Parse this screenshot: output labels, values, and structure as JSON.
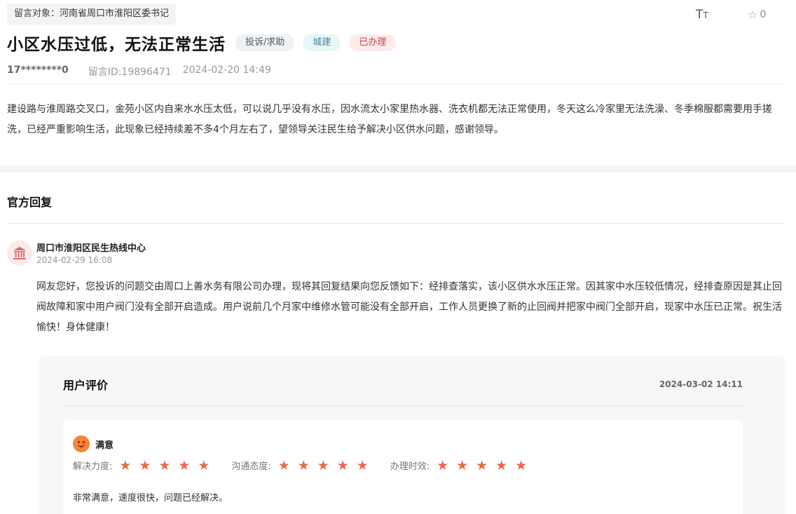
{
  "header": {
    "target_label": "留言对象：",
    "target_value": "河南省周口市淮阳区委书记",
    "font_toggle_big": "T",
    "font_toggle_small": "T",
    "favorite_count": "0"
  },
  "message": {
    "title": "小区水压过低，无法正常生活",
    "tags": [
      "投诉/求助",
      "城建",
      "已办理"
    ],
    "phone": "17********0",
    "message_id": "留言ID:19896471",
    "datetime": "2024-02-20 14:49",
    "content": "建设路与淮周路交叉口，金苑小区内自来水水压太低，可以说几乎没有水压，因水流太小家里热水器、洗衣机都无法正常使用，冬天这么冷家里无法洗澡、冬季棉服都需要用手搓洗，已经严重影响生活，此现象已经持续差不多4个月左右了，望领导关注民生给予解决小区供水问题，感谢领导。"
  },
  "reply": {
    "section_title": "官方回复",
    "org_name": "周口市淮阳区民生热线中心",
    "time": "2024-02-29 16:08",
    "content": "网友您好，您投诉的问题交由周口上善水务有限公司办理，现将其回复结果向您反馈如下：经排查落实，该小区供水水压正常。因其家中水压较低情况，经排查原因是其止回阀故障和家中用户阀门没有全部开启造成。用户说前几个月家中维修水管可能没有全部开启，工作人员更换了新的止回阀并把家中阀门全部开启，现家中水压已正常。祝生活愉快！身体健康！"
  },
  "evaluation": {
    "title": "用户评价",
    "time": "2024-03-02 14:11",
    "mood": "满意",
    "ratings": [
      {
        "label": "解决力度:",
        "stars": 5
      },
      {
        "label": "沟通态度:",
        "stars": 5
      },
      {
        "label": "办理时效:",
        "stars": 5
      }
    ],
    "comment": "非常满意，速度很快，问题已经解决。"
  },
  "colors": {
    "accent_red": "#c8444a",
    "star": "#e96a4a",
    "mood_face": "#f7833a"
  }
}
